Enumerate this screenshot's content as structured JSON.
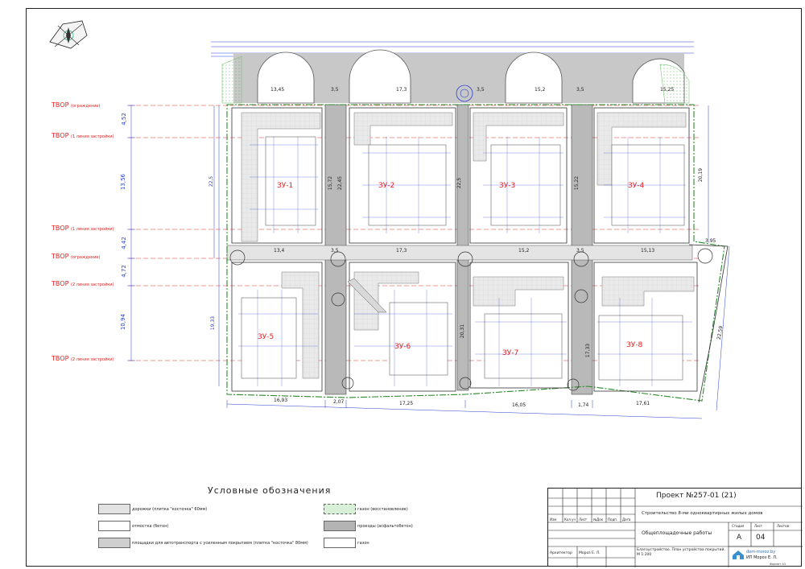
{
  "plots": [
    {
      "id": "plot1",
      "label": "ЗУ-1"
    },
    {
      "id": "plot2",
      "label": "ЗУ-2"
    },
    {
      "id": "plot3",
      "label": "ЗУ-3"
    },
    {
      "id": "plot4",
      "label": "ЗУ-4"
    },
    {
      "id": "plot5",
      "label": "ЗУ-5"
    },
    {
      "id": "plot6",
      "label": "ЗУ-6"
    },
    {
      "id": "plot7",
      "label": "ЗУ-7"
    },
    {
      "id": "plot8",
      "label": "ЗУ-8"
    }
  ],
  "tvor_lines": [
    {
      "main": "ТВОР",
      "sub": "(ограждение)"
    },
    {
      "main": "ТВОР",
      "sub": "(1 линия застройки)"
    },
    {
      "main": "ТВОР",
      "sub": "(1 линия застройки)"
    },
    {
      "main": "ТВОР",
      "sub": "(ограждение)"
    },
    {
      "main": "ТВОР",
      "sub": "(2 линия застройки)"
    },
    {
      "main": "ТВОР",
      "sub": "(2 линия застройки)"
    }
  ],
  "vertical_dims": [
    "4,52",
    "13,56",
    "4,42",
    "4,72",
    "10,94",
    "22,5",
    "19,33"
  ],
  "top_dims": [
    "13,45",
    "3,5",
    "17,3",
    "3,5",
    "15,2",
    "3,5",
    "15,25"
  ],
  "mid_dims": [
    "13,4",
    "3,5",
    "17,3",
    "15,2",
    "3,5",
    "15,13",
    "3,95"
  ],
  "bottom_dims": [
    "16,93",
    "2,07",
    "17,25",
    "16,05",
    "1,74",
    "17,61"
  ],
  "side_dims": [
    "20,19",
    "22,59"
  ],
  "passage_dims": [
    "15,72",
    "22,45",
    "22,5",
    "15,22",
    "20,31",
    "17,33"
  ],
  "legend": {
    "title": "Условные обозначения",
    "items": [
      {
        "label": "дорожки (плитка \"косточка\" 60мм)",
        "swatch": "#e2e2e2"
      },
      {
        "label": "отмостка (бетон)",
        "swatch": "#ffffff"
      },
      {
        "label": "площадки для автотранспорта с усиленным покрытием (плитка \"косточка\" 80мм)",
        "swatch": "#cfcfcf"
      },
      {
        "label": "газон (восстановление)",
        "swatch": "#d8f0d8"
      },
      {
        "label": "проезды (асфальтобетон)",
        "swatch": "#b4b4b4"
      },
      {
        "label": "газон",
        "swatch": "#ffffff"
      }
    ]
  },
  "title_block": {
    "project": "Проект №257-01 (21)",
    "description": "Строительство 8-ми одноквартирных жилых домов",
    "section": "Общеплощадочные работы",
    "stage_header": "Стадия",
    "sheet_header": "Лист",
    "sheets_header": "Листов",
    "stage": "А",
    "sheet": "04",
    "drawing": "Благоустройство. План устройства покрытий. М 1:200",
    "architect_role": "Архитектор",
    "architect_name": "Мороз Е. Л.",
    "columns": [
      "Изм",
      "Кол.уч",
      "Лист",
      "№Док",
      "Подп.",
      "Дата"
    ],
    "company_site": "dom-moroz.by",
    "company_name": "ИП Мороз Е. Л.",
    "format": "Формат А3"
  }
}
